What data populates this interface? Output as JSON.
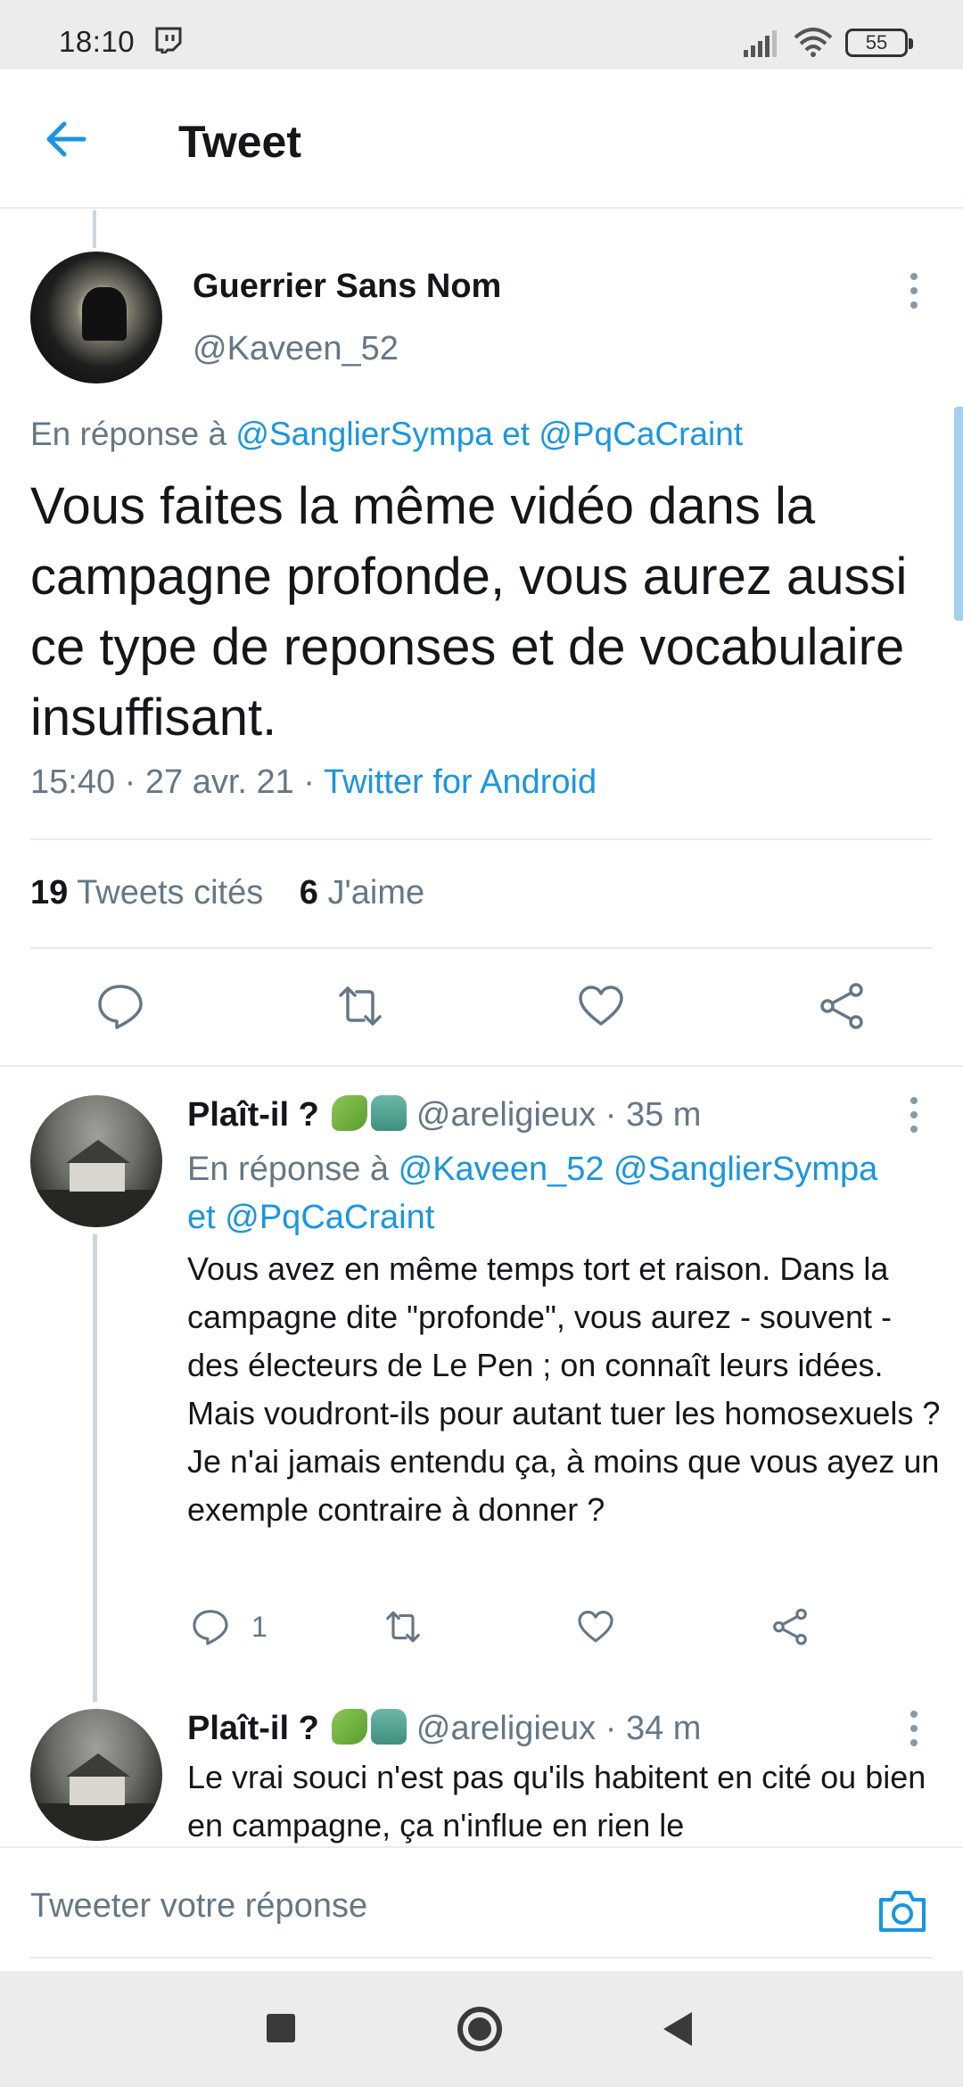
{
  "status_bar": {
    "time": "18:10",
    "battery": "55",
    "icons": [
      "twitch-icon",
      "signal-icon",
      "wifi-icon",
      "battery-icon"
    ]
  },
  "header": {
    "title": "Tweet",
    "back_icon": "arrow-left-icon"
  },
  "main_tweet": {
    "name": "Guerrier Sans Nom",
    "handle": "@Kaveen_52",
    "reply_prefix": "En réponse à",
    "reply_mention_1": "@SanglierSympa",
    "reply_connector": "et",
    "reply_mention_2": "@PqCaCraint",
    "text": "Vous faites la même vidéo dans la campagne profonde, vous aurez aussi ce type de reponses et de vocabulaire insuffisant.",
    "time": "15:40",
    "date": "27 avr. 21",
    "source": "Twitter for Android",
    "quotes_count": "19",
    "quotes_label": "Tweets cités",
    "likes_count": "6",
    "likes_label": "J'aime"
  },
  "replies": [
    {
      "name": "Plaît-il ?",
      "handle": "@areligieux",
      "time": "35 m",
      "reply_prefix": "En réponse à",
      "reply_mentions_line1": "@Kaveen_52 @SanglierSympa",
      "reply_connector": "et",
      "reply_mention_last": "@PqCaCraint",
      "text": "Vous avez en même temps tort et raison. Dans la campagne dite \"profonde\", vous aurez - souvent - des électeurs de Le Pen ; on connaît leurs idées. Mais voudront-ils pour autant tuer les homosexuels ? Je n'ai jamais entendu ça, à moins que vous ayez un exemple contraire à donner ?",
      "reply_count": "1"
    },
    {
      "name": "Plaît-il ?",
      "handle": "@areligieux",
      "time": "34 m",
      "text": "Le vrai souci n'est pas qu'ils habitent en cité ou bien en campagne, ça n'influe en rien le"
    }
  ],
  "compose": {
    "placeholder": "Tweeter votre réponse"
  },
  "colors": {
    "accent": "#1b95e0",
    "secondary_text": "#657786",
    "primary_text": "#14171a",
    "divider": "#e6ecf0"
  }
}
